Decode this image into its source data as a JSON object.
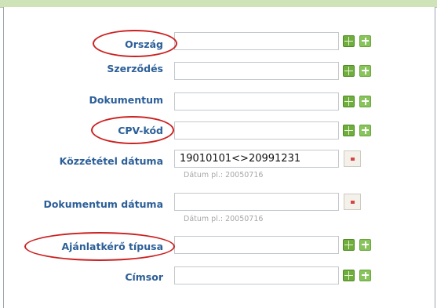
{
  "form": {
    "fields": [
      {
        "label": "Ország",
        "value": "",
        "buttons": [
          "grid-icon",
          "plus-icon"
        ]
      },
      {
        "label": "Szerződés",
        "value": "",
        "buttons": [
          "grid-icon",
          "plus-icon"
        ]
      },
      {
        "label": "Dokumentum",
        "value": "",
        "buttons": [
          "grid-icon",
          "plus-icon"
        ]
      },
      {
        "label": "CPV-kód",
        "value": "",
        "buttons": [
          "grid-icon",
          "plus-icon"
        ]
      },
      {
        "label": "Közzététel dátuma",
        "value": "19010101<>20991231",
        "hint": "Dátum pl.: 20050716",
        "buttons": [
          "calendar-icon"
        ]
      },
      {
        "label": "Dokumentum dátuma",
        "value": "",
        "hint": "Dátum pl.: 20050716",
        "buttons": [
          "calendar-icon"
        ]
      },
      {
        "label": "Ajánlatkérő típusa",
        "value": "",
        "buttons": [
          "grid-icon",
          "plus-icon"
        ]
      },
      {
        "label": "Címsor",
        "value": "",
        "buttons": [
          "grid-icon",
          "plus-icon"
        ]
      }
    ]
  },
  "colors": {
    "label": "#2c5f98",
    "highlight": "#cc2020",
    "icon_green": "#6fae3c"
  }
}
